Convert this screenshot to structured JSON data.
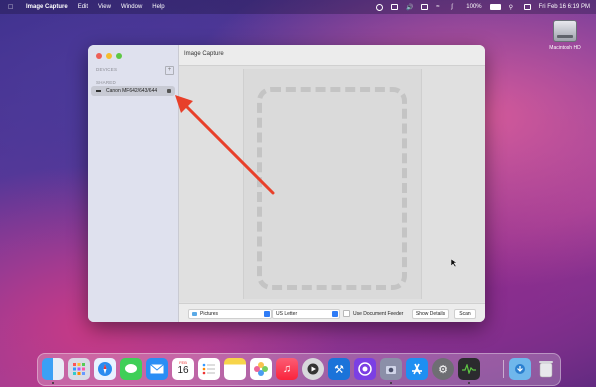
{
  "menubar": {
    "app_name": "Image Capture",
    "menus": [
      "Edit",
      "View",
      "Window",
      "Help"
    ],
    "battery": "100%",
    "datetime": "Fri Feb 16  6:19 PM"
  },
  "desktop": {
    "hdd_label": "Macintosh HD"
  },
  "window": {
    "title": "Image Capture",
    "sidebar": {
      "devices_heading": "DEVICES",
      "shared_heading": "SHARED",
      "device_name": "Canon MF642/643/644"
    },
    "bottombar": {
      "folder_value": "Pictures",
      "paper_value": "US Letter",
      "feeder_label": "Use Document Feeder",
      "feeder_checked": false,
      "details_label": "Show Details",
      "scan_label": "Scan"
    }
  },
  "dock": {
    "calendar_month": "FEB",
    "calendar_day": "16",
    "apps": [
      "Finder",
      "Launchpad",
      "Safari",
      "Messages",
      "Mail",
      "Calendar",
      "Reminders",
      "Notes",
      "Photos",
      "Music",
      "QuickTime Player",
      "Xcode",
      "GitHub Desktop",
      "Image Capture",
      "App Store",
      "System Settings",
      "Activity Monitor",
      "Downloads",
      "Trash"
    ]
  },
  "colors": {
    "arrow": "#e8402a",
    "accent": "#2f7cf6"
  }
}
